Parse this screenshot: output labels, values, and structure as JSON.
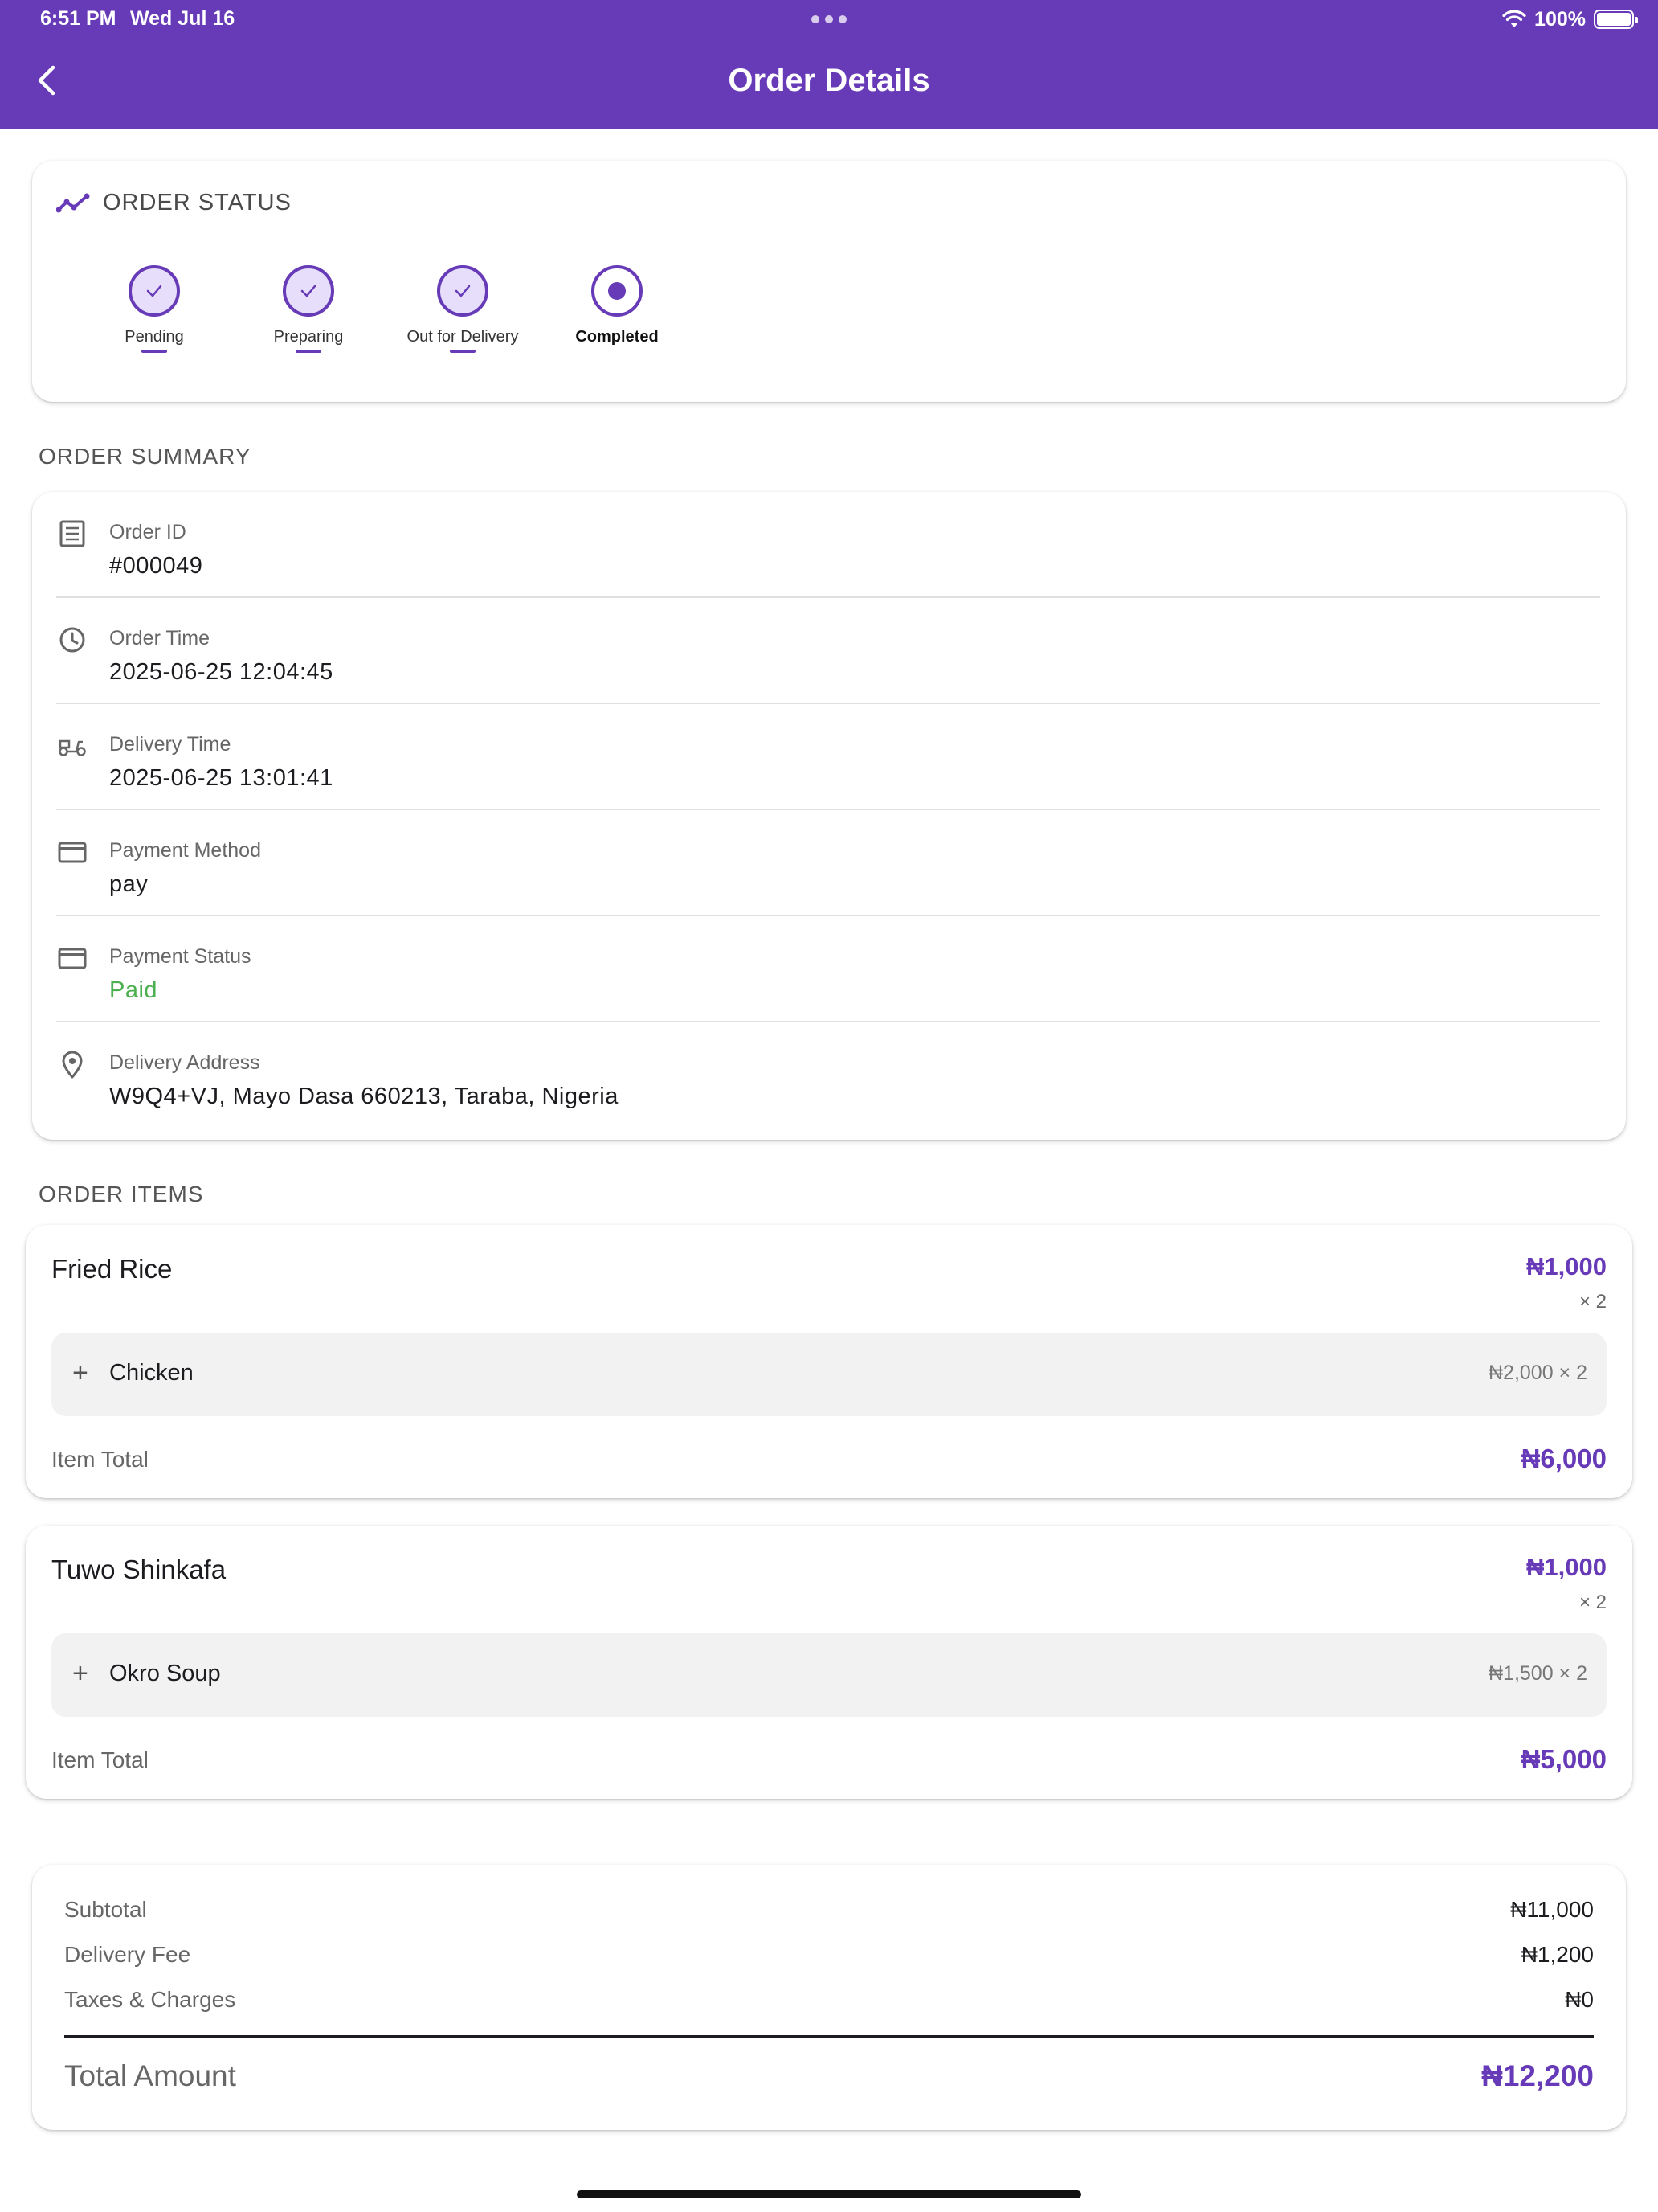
{
  "status_bar": {
    "time": "6:51 PM",
    "date": "Wed Jul 16",
    "battery": "100%"
  },
  "header": {
    "title": "Order Details"
  },
  "order_status": {
    "label": "ORDER STATUS",
    "steps": [
      {
        "label": "Pending",
        "state": "done"
      },
      {
        "label": "Preparing",
        "state": "done"
      },
      {
        "label": "Out for Delivery",
        "state": "done"
      },
      {
        "label": "Completed",
        "state": "current"
      }
    ]
  },
  "summary": {
    "section_title": "ORDER SUMMARY",
    "rows": [
      {
        "label": "Order ID",
        "value": "#000049",
        "icon": "receipt-icon"
      },
      {
        "label": "Order Time",
        "value": "2025-06-25 12:04:45",
        "icon": "clock-icon"
      },
      {
        "label": "Delivery Time",
        "value": "2025-06-25 13:01:41",
        "icon": "scooter-icon"
      },
      {
        "label": "Payment Method",
        "value": "pay",
        "icon": "card-icon"
      },
      {
        "label": "Payment Status",
        "value": "Paid",
        "icon": "card-icon"
      },
      {
        "label": "Delivery Address",
        "value": "W9Q4+VJ, Mayo Dasa 660213, Taraba, Nigeria",
        "icon": "location-pin-icon"
      }
    ]
  },
  "items": {
    "section_title": "ORDER ITEMS",
    "list": [
      {
        "name": "Fried Rice",
        "price": "₦1,000",
        "qty": "× 2",
        "addon": {
          "name": "Chicken",
          "price": "₦2,000 × 2"
        },
        "total_label": "Item Total",
        "total": "₦6,000"
      },
      {
        "name": "Tuwo Shinkafa",
        "price": "₦1,000",
        "qty": "× 2",
        "addon": {
          "name": "Okro Soup",
          "price": "₦1,500 × 2"
        },
        "total_label": "Item Total",
        "total": "₦5,000"
      }
    ]
  },
  "totals": {
    "subtotal_label": "Subtotal",
    "subtotal": "₦11,000",
    "delivery_label": "Delivery Fee",
    "delivery": "₦1,200",
    "taxes_label": "Taxes & Charges",
    "taxes": "₦0",
    "grand_label": "Total Amount",
    "grand": "₦12,200"
  },
  "colors": {
    "primary": "#673ab7",
    "paid": "#4caf50"
  }
}
